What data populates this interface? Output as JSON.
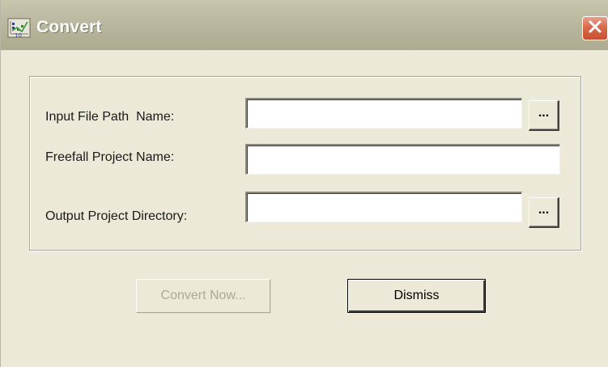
{
  "window": {
    "title": "Convert",
    "icon": "app-chart-icon",
    "close_icon": "close-icon"
  },
  "form": {
    "fields": [
      {
        "label": "Input File Path  Name:",
        "value": "",
        "placeholder": "",
        "has_browse": true
      },
      {
        "label": "Freefall Project Name:",
        "value": "",
        "placeholder": "",
        "has_browse": false
      },
      {
        "label": "Output Project Directory:",
        "value": "",
        "placeholder": "",
        "has_browse": true
      }
    ],
    "browse_label": "..."
  },
  "buttons": {
    "convert_label": "Convert Now...",
    "convert_enabled": false,
    "dismiss_label": "Dismiss"
  },
  "colors": {
    "dialog_bg": "#ece9d8",
    "titlebar": "#b9b79e",
    "close_button": "#d96a4d",
    "disabled_text": "#aca899"
  }
}
